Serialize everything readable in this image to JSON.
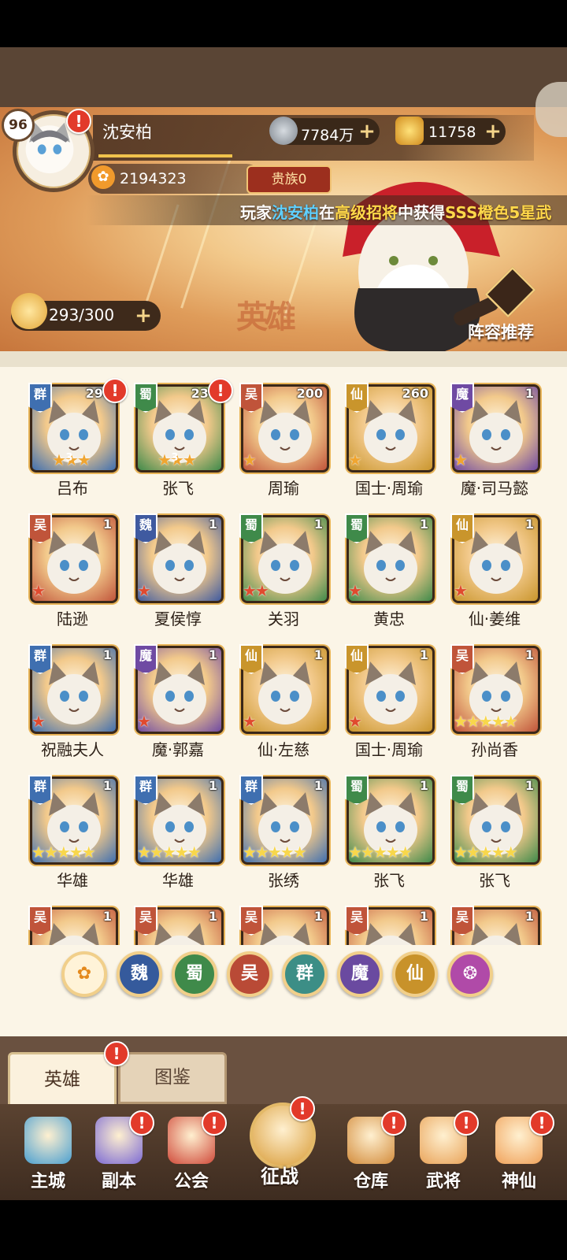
{
  "player": {
    "level": "96",
    "name": "沈安柏",
    "paw_points": "2194323",
    "noble": "贵族0",
    "stamina": "293/300"
  },
  "currency": {
    "copper": "7784万",
    "gold": "11758"
  },
  "marquee": {
    "prefix": "玩家",
    "player": "沈安柏",
    "middle1": "在",
    "event": "高级招将",
    "middle2": "中获得",
    "reward": "SSS橙色5星武"
  },
  "header": {
    "lineup_button": "阵容推荐",
    "calligraphy": "英雄"
  },
  "heroes": [
    {
      "name": "吕布",
      "faction": "群",
      "level": "290",
      "stars": 3,
      "star_color": "orange",
      "star_num": "3",
      "alert": true
    },
    {
      "name": "张飞",
      "faction": "蜀",
      "level": "230",
      "stars": 3,
      "star_color": "orange",
      "star_num": "3",
      "alert": true
    },
    {
      "name": "周瑜",
      "faction": "吴",
      "level": "200",
      "stars": 1,
      "star_color": "orange",
      "star_num": "",
      "alert": false
    },
    {
      "name": "国士·周瑜",
      "faction": "仙",
      "level": "260",
      "stars": 1,
      "star_color": "orange",
      "star_num": "",
      "alert": false
    },
    {
      "name": "魔·司马懿",
      "faction": "魔",
      "level": "1",
      "stars": 1,
      "star_color": "orange",
      "star_num": "",
      "alert": false
    },
    {
      "name": "陆逊",
      "faction": "吴",
      "level": "1",
      "stars": 1,
      "star_color": "red",
      "star_num": "",
      "alert": false
    },
    {
      "name": "夏侯惇",
      "faction": "魏",
      "level": "1",
      "stars": 1,
      "star_color": "red",
      "star_num": "",
      "alert": false
    },
    {
      "name": "关羽",
      "faction": "蜀",
      "level": "1",
      "stars": 2,
      "star_color": "red",
      "star_num": "",
      "alert": false
    },
    {
      "name": "黄忠",
      "faction": "蜀",
      "level": "1",
      "stars": 1,
      "star_color": "red",
      "star_num": "",
      "alert": false
    },
    {
      "name": "仙·姜维",
      "faction": "仙",
      "level": "1",
      "stars": 1,
      "star_color": "red",
      "star_num": "",
      "alert": false
    },
    {
      "name": "祝融夫人",
      "faction": "群",
      "level": "1",
      "stars": 1,
      "star_color": "red",
      "star_num": "",
      "alert": false
    },
    {
      "name": "魔·郭嘉",
      "faction": "魔",
      "level": "1",
      "stars": 1,
      "star_color": "red",
      "star_num": "",
      "alert": false
    },
    {
      "name": "仙·左慈",
      "faction": "仙",
      "level": "1",
      "stars": 1,
      "star_color": "red",
      "star_num": "",
      "alert": false
    },
    {
      "name": "国士·周瑜",
      "faction": "仙",
      "level": "1",
      "stars": 1,
      "star_color": "red",
      "star_num": "",
      "alert": false
    },
    {
      "name": "孙尚香",
      "faction": "吴",
      "level": "1",
      "stars": 5,
      "star_color": "gold",
      "star_num": "",
      "alert": false
    },
    {
      "name": "华雄",
      "faction": "群",
      "level": "1",
      "stars": 5,
      "star_color": "gold",
      "star_num": "",
      "alert": false
    },
    {
      "name": "华雄",
      "faction": "群",
      "level": "1",
      "stars": 5,
      "star_color": "gold",
      "star_num": "",
      "alert": false
    },
    {
      "name": "张绣",
      "faction": "群",
      "level": "1",
      "stars": 5,
      "star_color": "gold",
      "star_num": "",
      "alert": false
    },
    {
      "name": "张飞",
      "faction": "蜀",
      "level": "1",
      "stars": 5,
      "star_color": "gold",
      "star_num": "",
      "alert": false
    },
    {
      "name": "张飞",
      "faction": "蜀",
      "level": "1",
      "stars": 5,
      "star_color": "gold",
      "star_num": "",
      "alert": false
    },
    {
      "name": "",
      "faction": "吴",
      "level": "1",
      "stars": 0,
      "star_color": "gold",
      "star_num": "",
      "alert": false
    },
    {
      "name": "",
      "faction": "吴",
      "level": "1",
      "stars": 0,
      "star_color": "gold",
      "star_num": "",
      "alert": false
    },
    {
      "name": "",
      "faction": "吴",
      "level": "1",
      "stars": 0,
      "star_color": "gold",
      "star_num": "",
      "alert": false
    },
    {
      "name": "",
      "faction": "吴",
      "level": "1",
      "stars": 0,
      "star_color": "gold",
      "star_num": "",
      "alert": false
    },
    {
      "name": "",
      "faction": "吴",
      "level": "1",
      "stars": 0,
      "star_color": "gold",
      "star_num": "",
      "alert": false
    }
  ],
  "faction_colors": {
    "群": "#3f6fb0",
    "蜀": "#3f8a4a",
    "吴": "#c0543a",
    "仙": "#c9952c",
    "魔": "#6f4aa3",
    "魏": "#3f5aa0"
  },
  "filters": [
    {
      "label": "paw-icon",
      "icon": "paw-icon",
      "color": "#e8a33a"
    },
    {
      "label": "魏",
      "color": "#355a9c"
    },
    {
      "label": "蜀",
      "color": "#3f8a4a"
    },
    {
      "label": "吴",
      "color": "#b94a36"
    },
    {
      "label": "群",
      "color": "#3c8e86"
    },
    {
      "label": "魔",
      "color": "#6a4aa0"
    },
    {
      "label": "仙",
      "color": "#c8922a"
    },
    {
      "label": "spirit-icon",
      "icon": "spirit-icon",
      "color": "#b04aa8"
    }
  ],
  "tabs": {
    "heroes": "英雄",
    "atlas": "图鉴"
  },
  "nav": [
    {
      "label": "主城",
      "icon": "castle-icon",
      "alert": false
    },
    {
      "label": "副本",
      "icon": "sword-icon",
      "alert": true
    },
    {
      "label": "公会",
      "icon": "flag-icon",
      "alert": true
    },
    {
      "label": "征战",
      "icon": "battle-icon",
      "alert": true
    },
    {
      "label": "仓库",
      "icon": "bag-icon",
      "alert": true
    },
    {
      "label": "武将",
      "icon": "general-icon",
      "alert": true
    },
    {
      "label": "神仙",
      "icon": "immortal-cat-icon",
      "alert": true
    }
  ]
}
